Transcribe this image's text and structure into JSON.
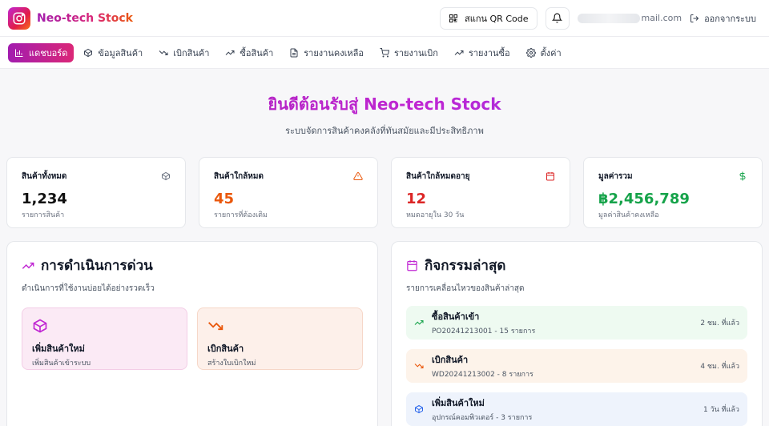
{
  "header": {
    "brand": "Neo-tech Stock",
    "qr_label": "สแกน QR Code",
    "email_visible": "mail.com",
    "logout_label": "ออกจากระบบ"
  },
  "nav": {
    "items": [
      {
        "label": "แดชบอร์ด",
        "icon": "bar-chart-icon",
        "active": true
      },
      {
        "label": "ข้อมูลสินค้า",
        "icon": "package-icon"
      },
      {
        "label": "เบิกสินค้า",
        "icon": "trending-down-icon"
      },
      {
        "label": "ซื้อสินค้า",
        "icon": "trending-up-icon"
      },
      {
        "label": "รายงานคงเหลือ",
        "icon": "file-text-icon"
      },
      {
        "label": "รายงานเบิก",
        "icon": "cart-icon"
      },
      {
        "label": "รายงานซื้อ",
        "icon": "trending-up-icon"
      },
      {
        "label": "ตั้งค่า",
        "icon": "gear-icon"
      }
    ]
  },
  "hero": {
    "title": "ยินดีต้อนรับสู่ Neo-tech Stock",
    "subtitle": "ระบบจัดการสินค้าคงคลังที่ทันสมัยและมีประสิทธิภาพ"
  },
  "stats": [
    {
      "label": "สินค้าทั้งหมด",
      "value": "1,234",
      "sub": "รายการสินค้า",
      "color": "#111111",
      "icon": "package-icon"
    },
    {
      "label": "สินค้าใกล้หมด",
      "value": "45",
      "sub": "รายการที่ต้องเติม",
      "color": "#ea580c",
      "icon": "warning-icon"
    },
    {
      "label": "สินค้าใกล้หมดอายุ",
      "value": "12",
      "sub": "หมดอายุใน 30 วัน",
      "color": "#dc2626",
      "icon": "calendar-icon"
    },
    {
      "label": "มูลค่ารวม",
      "value": "฿2,456,789",
      "sub": "มูลค่าสินค้าคงเหลือ",
      "color": "#16a34a",
      "icon": "dollar-icon"
    }
  ],
  "quick": {
    "title": "การดำเนินการด่วน",
    "subtitle": "ดำเนินการที่ใช้งานบ่อยได้อย่างรวดเร็ว",
    "actions": [
      {
        "title": "เพิ่มสินค้าใหม่",
        "sub": "เพิ่มสินค้าเข้าระบบ",
        "icon": "package-icon"
      },
      {
        "title": "เบิกสินค้า",
        "sub": "สร้างใบเบิกใหม่",
        "icon": "trending-down-icon"
      }
    ]
  },
  "recent": {
    "title": "กิจกรรมล่าสุด",
    "subtitle": "รายการเคลื่อนไหวของสินค้าล่าสุด",
    "items": [
      {
        "title": "ซื้อสินค้าเข้า",
        "sub": "PO20241213001 - 15 รายการ",
        "time": "2 ชม. ที่แล้ว",
        "icon": "trending-up-icon"
      },
      {
        "title": "เบิกสินค้า",
        "sub": "WD20241213002 - 8 รายการ",
        "time": "4 ชม. ที่แล้ว",
        "icon": "trending-down-icon"
      },
      {
        "title": "เพิ่มสินค้าใหม่",
        "sub": "อุปกรณ์คอมพิวเตอร์ - 3 รายการ",
        "time": "1 วัน ที่แล้ว",
        "icon": "package-icon"
      }
    ]
  }
}
